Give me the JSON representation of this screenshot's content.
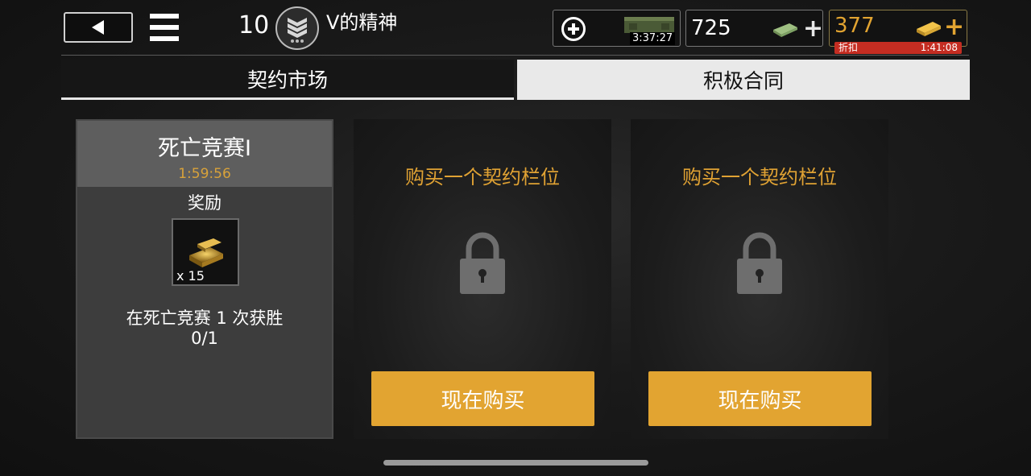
{
  "header": {
    "level": "10",
    "player_name": "V的精神",
    "crate_timer": "3:37:27",
    "cash_amount": "725",
    "gold_amount": "377",
    "discount_label": "折扣",
    "discount_timer": "1:41:08"
  },
  "tabs": [
    {
      "label": "契约市场",
      "active": false
    },
    {
      "label": "积极合同",
      "active": true
    }
  ],
  "contract": {
    "title": "死亡竞赛I",
    "timer": "1:59:56",
    "reward_label": "奖励",
    "reward_qty": "x 15",
    "reward_icon": "gold-bars-icon",
    "objective": "在死亡竞赛 1 次获胜",
    "progress": "0/1"
  },
  "locked_slots": [
    {
      "title": "购买一个契约栏位",
      "button_label": "现在购买"
    },
    {
      "title": "购买一个契约栏位",
      "button_label": "现在购买"
    }
  ],
  "colors": {
    "accent": "#e2a431",
    "discount_red": "#c42d22",
    "gold_text": "#d8a23a"
  }
}
